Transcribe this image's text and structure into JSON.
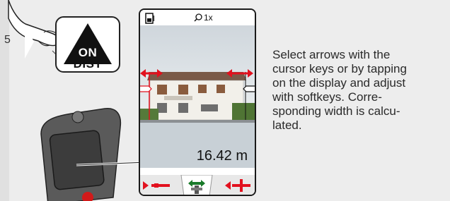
{
  "step": {
    "number": "5"
  },
  "button": {
    "line1": "ON",
    "line2": "DIST",
    "icon": "on-dist-button"
  },
  "display": {
    "status": {
      "battery_icon": "battery-icon",
      "zoom_icon": "magnifier-icon",
      "zoom_label": "1x"
    },
    "measurement": {
      "value": "16.42 m"
    },
    "softkeys": {
      "left_icon": "arrows-closer-icon",
      "middle_icon": "width-measure-icon",
      "right_icon": "arrows-apart-icon"
    },
    "colors": {
      "arrow": "#e2111e",
      "softkey_bar": "#e8e8e8",
      "middle_key": "#ffffff"
    }
  },
  "instructions": {
    "lines": [
      "Select arrows with the",
      "cursor keys or by tapping",
      "on the display and adjust",
      "with softkeys. Corre-",
      "sponding width is calcu-",
      "lated."
    ]
  }
}
